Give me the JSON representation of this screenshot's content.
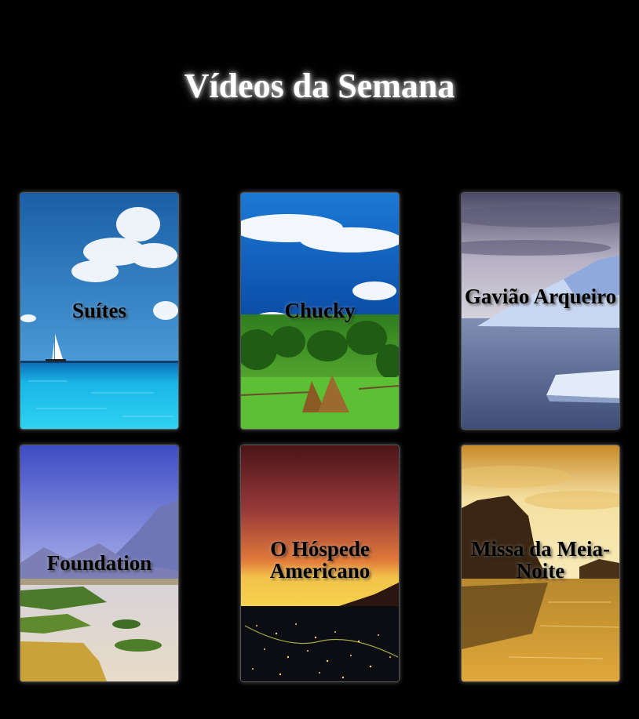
{
  "page": {
    "title": "Vídeos da Semana"
  },
  "videos": [
    {
      "label": "Suítes",
      "scene": "tropical-sea-sailboat"
    },
    {
      "label": "Chucky",
      "scene": "green-valley-haystacks"
    },
    {
      "label": "Gavião Arqueiro",
      "scene": "icebergs-cloudy-sky"
    },
    {
      "label": "Foundation",
      "scene": "river-mountains-fields"
    },
    {
      "label": "O Hóspede Americano",
      "scene": "sunset-city-lights"
    },
    {
      "label": "Missa da Meia-Noite",
      "scene": "golden-beach-rocks"
    }
  ],
  "colors": {
    "background": "#000000",
    "title": "#ffffff",
    "card_label": "#000000"
  }
}
